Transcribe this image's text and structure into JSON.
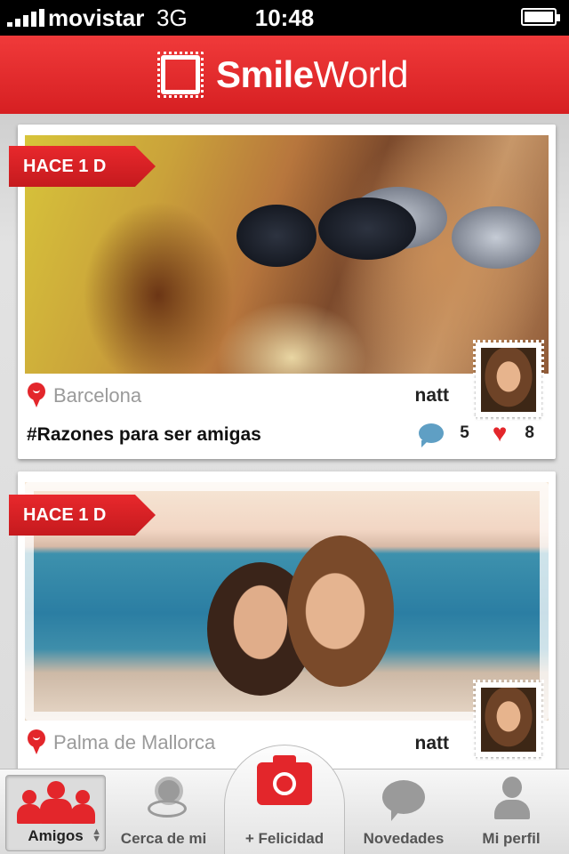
{
  "status_bar": {
    "carrier": "movistar",
    "network": "3G",
    "time": "10:48"
  },
  "header": {
    "title_bold": "Smile",
    "title_light": "World"
  },
  "posts": [
    {
      "time_badge": "HACE 1 D",
      "location": "Barcelona",
      "username": "natt",
      "title": "#Razones para ser amigas",
      "comments": "5",
      "likes": "8"
    },
    {
      "time_badge": "HACE 1 D",
      "location": "Palma de Mallorca",
      "username": "natt"
    }
  ],
  "tab_bar": {
    "tabs": [
      {
        "label": "Amigos",
        "icon": "friends-icon",
        "selected": true
      },
      {
        "label": "Cerca de mi",
        "icon": "location-pins-icon"
      },
      {
        "label": "+ Felicidad",
        "icon": "camera-icon"
      },
      {
        "label": "Novedades",
        "icon": "speech-bubble-icon"
      },
      {
        "label": "Mi perfil",
        "icon": "profile-icon"
      }
    ]
  },
  "colors": {
    "brand_red": "#e3262b",
    "background": "#d6d6d6",
    "comment_blue": "#5f9fc4"
  }
}
